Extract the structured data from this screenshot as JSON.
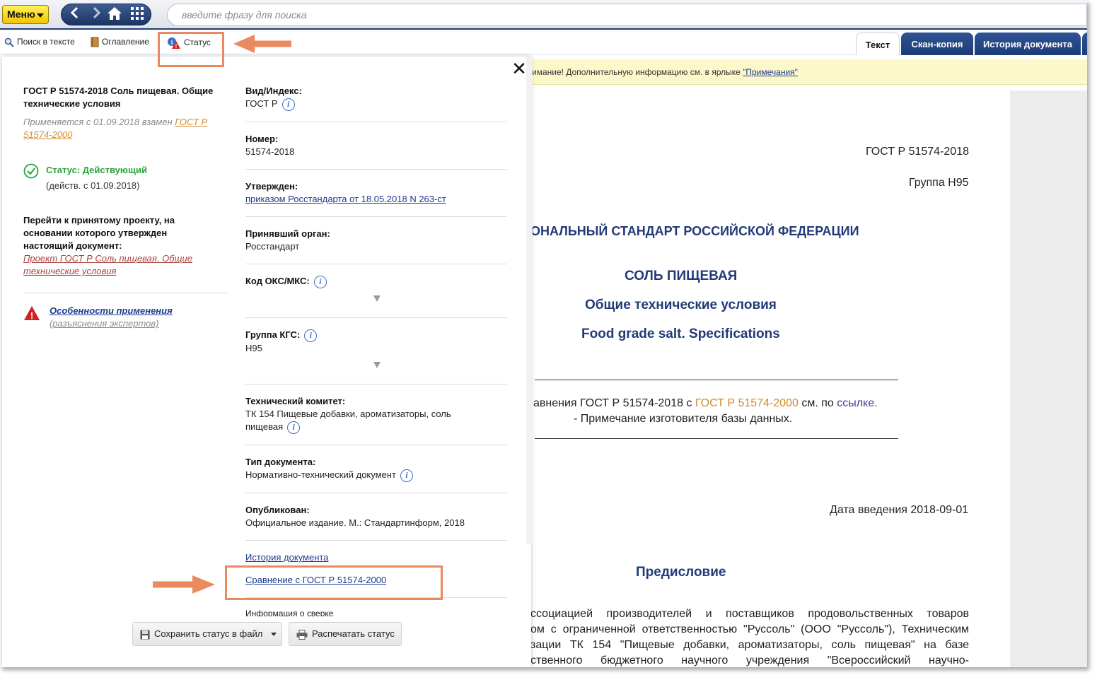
{
  "topbar": {
    "menu_label": "Меню",
    "search_placeholder": "введите фразу для поиска"
  },
  "toolbar": {
    "search_in_text": "Поиск в тексте",
    "contents": "Оглавление",
    "status": "Статус"
  },
  "tabs": [
    "Текст",
    "Скан-копия",
    "История документа"
  ],
  "notice": {
    "text": "имание! Дополнительную информацию см. в ярлыке ",
    "link": "\"Примечания\""
  },
  "popup": {
    "left": {
      "title": "ГОСТ Р 51574-2018 Соль пищевая. Общие технические условия",
      "applies": "Применяется с 01.09.2018 взамен ",
      "replaces_link_1": "ГОСТ Р",
      "replaces_link_2": "51574-2000",
      "status_label": "Статус: Действующий",
      "status_since": "(действ. с 01.09.2018)",
      "project_text": "Перейти к принятому проекту, на основании которого утвержден настоящий документ:",
      "project_link": "Проект ГОСТ Р Соль пищевая. Общие технические условия",
      "features_link": "Особенности применения",
      "features_sub": "(разъяснения экспертов)"
    },
    "fields": {
      "kind_label": "Вид/Индекс:",
      "kind_value": "ГОСТ Р",
      "number_label": "Номер:",
      "number_value": "51574-2018",
      "approved_label": "Утвержден:",
      "approved_value": "приказом Росстандарта от 18.05.2018 N 263-ст",
      "body_label": "Принявший орган:",
      "body_value": "Росстандарт",
      "oks_label": "Код ОКС/МКС:",
      "kgs_label": "Группа КГС:",
      "kgs_value": "Н95",
      "tc_label": "Технический комитет:",
      "tc_value_1": "ТК 154 Пищевые добавки, ароматизаторы, соль",
      "tc_value_2": "пищевая",
      "type_label": "Тип документа:",
      "type_value": "Нормативно-технический документ",
      "published_label": "Опубликован:",
      "published_value": "Официальное издание. М.: Стандартинформ, 2018",
      "history_link": "История документа",
      "compare_link": "Сравнение с ГОСТ Р 51574-2000",
      "verify_text": "Информация о сверке"
    },
    "save_button": "Сохранить статус в файл",
    "print_button": "Распечатать статус",
    "close_symbol": "✕"
  },
  "document": {
    "code": "ГОСТ Р 51574-2018",
    "group": "Группа Н95",
    "national": "ОНАЛЬНЫЙ СТАНДАРТ РОССИЙСКОЙ ФЕДЕРАЦИИ",
    "title": "СОЛЬ ПИЩЕВАЯ",
    "subtitle": "Общие технические условия",
    "title_en": "Food grade salt. Specifications",
    "cmp_a": "авнения ГОСТ Р 51574-2018 с ",
    "cmp_link": "ГОСТ Р 51574-2000",
    "cmp_b": " см. по ",
    "cmp_link2": "ссылке",
    "cmp_c": ".",
    "note": "- Примечание изготовителя базы данных.",
    "intro_date": "Дата введения 2018-09-01",
    "foreword": "Предисловие",
    "para_1": "ссоциацией производителей и поставщиков продовольственных товаров",
    "para_2": "ом с ограниченной ответственностью \"Руссоль\" (ООО \"Руссоль\"), Техническим",
    "para_3": "зации ТК 154 \"Пищевые добавки, ароматизаторы, соль пищевая\" на базе",
    "para_4": "ственного бюджетного научного учреждения \"Всероссийский научно-"
  },
  "colors": {
    "accent_dark": "#1d3c78",
    "status_green": "#27a43c",
    "highlight": "#ec8a5f",
    "notice_bg": "#fdf8c9"
  }
}
